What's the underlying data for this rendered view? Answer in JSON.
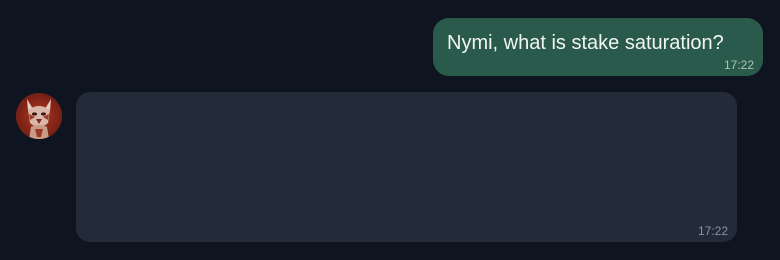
{
  "messages": [
    {
      "sender": "user",
      "text": "Nymi, what is stake saturation?",
      "time": "17:22"
    },
    {
      "sender": "bot",
      "text": "",
      "time": "17:22",
      "avatar_icon": "fox-mask-avatar-icon"
    }
  ],
  "colors": {
    "background": "#0f1520",
    "user_bubble": "#2a5a4b",
    "bot_bubble": "#232a38"
  }
}
